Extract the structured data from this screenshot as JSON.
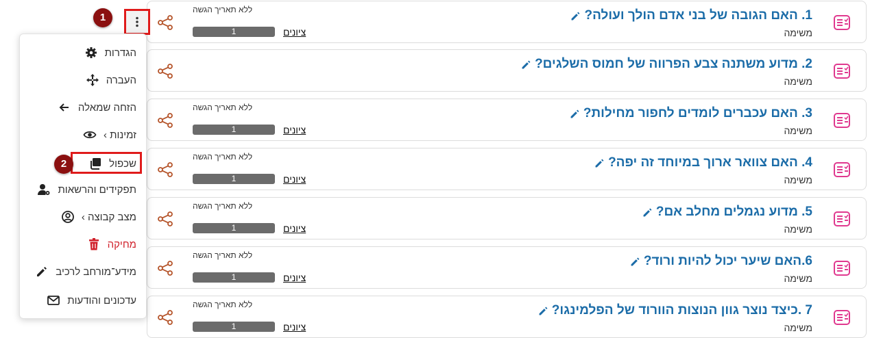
{
  "rows": [
    {
      "title": "1. האם הגובה של בני אדם הולך ועולה?",
      "type": "משימה",
      "due": "ללא תאריך הגשה",
      "grades": "ציונים",
      "value": "1"
    },
    {
      "title": "2. מדוע משתנה צבע הפרווה של חמוס השלגים?",
      "type": "משימה"
    },
    {
      "title": "3. האם עכברים לומדים לחפור מחילות?",
      "type": "משימה",
      "due": "ללא תאריך הגשה",
      "grades": "ציונים",
      "value": "1"
    },
    {
      "title": "4. האם צוואר ארוך במיוחד זה יפה?",
      "type": "משימה",
      "due": "ללא תאריך הגשה",
      "grades": "ציונים",
      "value": "1"
    },
    {
      "title": "5. מדוע נגמלים מחלב אם?",
      "type": "משימה",
      "due": "ללא תאריך הגשה",
      "grades": "ציונים",
      "value": "1"
    },
    {
      "title": "6.האם שיער יכול להיות ורוד?",
      "type": "משימה",
      "due": "ללא תאריך הגשה",
      "grades": "ציונים",
      "value": "1"
    },
    {
      "title": "7 .כיצד נוצר גוון הנוצות הוורוד של הפלמינגו?",
      "type": "משימה",
      "due": "ללא תאריך הגשה",
      "grades": "ציונים",
      "value": "1"
    }
  ],
  "menu": {
    "items": [
      {
        "label": "הגדרות",
        "icon": "gear-icon"
      },
      {
        "label": "העברה",
        "icon": "move-icon"
      },
      {
        "label": "הזחה שמאלה",
        "icon": "arrow-left-icon"
      },
      {
        "label": "זמינות ›",
        "icon": "eye-icon"
      },
      {
        "label": "שכפול",
        "icon": "copy-icon"
      },
      {
        "label": "תפקידים והרשאות",
        "icon": "user-cog-icon"
      },
      {
        "label": "מצב קבוצה ›",
        "icon": "user-circle-icon"
      },
      {
        "label": "מחיקה",
        "icon": "trash-icon"
      },
      {
        "label": "מידע־מורחב לרכיב",
        "icon": "pencil-icon"
      },
      {
        "label": "עדכונים והודעות",
        "icon": "envelope-icon"
      }
    ]
  },
  "annotations": {
    "step1": "1",
    "step2": "2"
  },
  "colors": {
    "title": "#1b6ca8",
    "task_icon": "#e0398f",
    "share": "#b5542a",
    "highlight": "#e01b1b",
    "badge": "#8b1010",
    "danger": "#d0202a"
  }
}
